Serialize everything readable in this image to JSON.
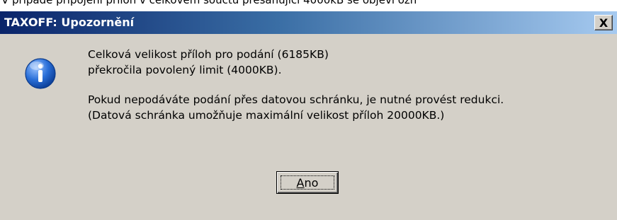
{
  "background_text": "V případě připojení příloh v celkovém součtu přesahující 4000kB se objeví ozn",
  "dialog": {
    "title": "TAXOFF: Upozornění",
    "close_glyph": "X",
    "icon": "info-icon",
    "message": {
      "paragraph1": [
        "Celková velikost příloh pro podání (6185KB)",
        "překročila povolený limit (4000KB)."
      ],
      "paragraph2": [
        "Pokud nepodáváte podání přes datovou schránku, je nutné provést redukci.",
        "(Datová schránka umožňuje maximální velikost příloh 20000KB.)"
      ]
    },
    "ok_button": {
      "accel": "A",
      "rest": "no"
    }
  },
  "colors": {
    "titlebar_start": "#0a246a",
    "titlebar_end": "#a6caf0",
    "face": "#d4d0c8",
    "icon_blue": "#1f5fbf"
  }
}
